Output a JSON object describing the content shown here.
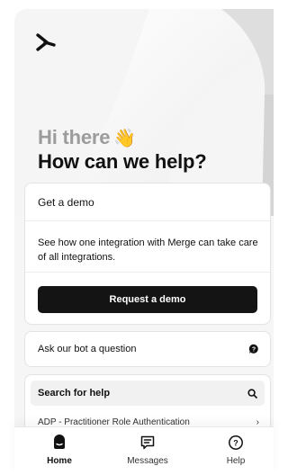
{
  "hero": {
    "greeting": "Hi there",
    "greeting_emoji": "👋",
    "headline": "How can we help?"
  },
  "demo_card": {
    "title": "Get a demo",
    "description": "See how one integration with Merge can take care of all integrations.",
    "button_label": "Request a demo"
  },
  "bot_card": {
    "label": "Ask our bot a question"
  },
  "help_card": {
    "search_label": "Search for help",
    "first_article": "ADP - Practitioner Role Authentication"
  },
  "nav": {
    "home": "Home",
    "messages": "Messages",
    "help": "Help"
  },
  "colors": {
    "accent": "#141414",
    "background": "#f6f6f6",
    "muted_text": "#9c9c9c"
  }
}
